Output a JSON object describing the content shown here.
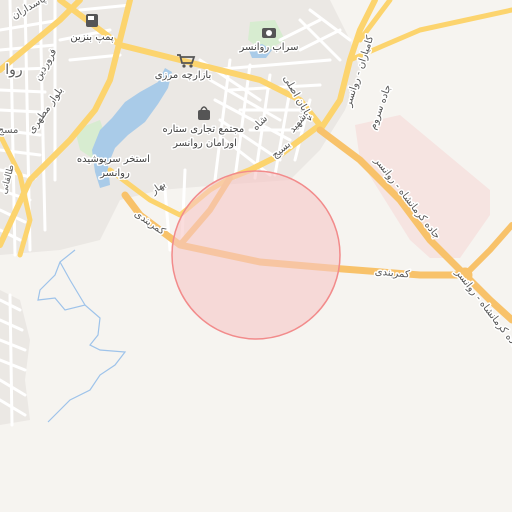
{
  "map": {
    "colors": {
      "background": "#f6f4f0",
      "urban": "#ebe8e4",
      "minor_road": "#ffffff",
      "major_road": "#fcd46e",
      "highway": "#f8c26a",
      "water": "#a9cbe8",
      "park": "#d7ecd0",
      "stream": "#9ec3ea",
      "highlight_fill": "#f7c6c6",
      "highlight_stroke": "#f28b8b"
    },
    "highlight_area": {
      "label": ""
    },
    "pois": [
      {
        "name": "پمپ بنزین",
        "icon": "fuel-icon"
      },
      {
        "name": "سراب روانسر",
        "icon": "photo-icon"
      },
      {
        "name": "بازارچه مرزی",
        "icon": "shopping-cart-icon"
      },
      {
        "name": "مجتمع تجاری ستاره اورامان روانسر",
        "icon": "shopping-bag-icon"
      },
      {
        "name": "استخر سرپوشیده روانسر",
        "icon": ""
      }
    ],
    "labels": {
      "pasdaran": "پاسداران",
      "ravansar_edge": "روا",
      "masjed_edge": "مسج",
      "taleghani": "طالقانی",
      "bolvar_motahari": "بلوار مطهری",
      "farvardin": "فروردین",
      "kheyaban_asli": "خیابان اصلی",
      "shahid": "شهید",
      "basij": "بسیج",
      "bahar": "بهار",
      "kamarbandi_left": "کمربندی",
      "kamarbandi_right": "کمربندی",
      "kamyaran_ravansar": "کامیاران - روانسر",
      "jadeh_sarvam": "جاده سروم",
      "jadeh_kermanshah_upper": "جاده کرمانشاه - روانسر",
      "jadeh_kermanshah_lower": "جاده کرمانشاه - روانسر",
      "shah": "شاه"
    }
  }
}
